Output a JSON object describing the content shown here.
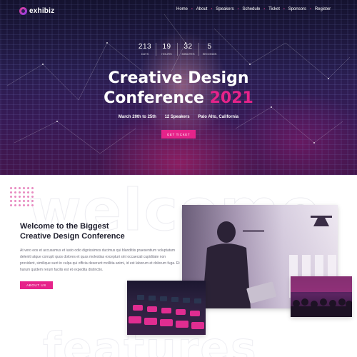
{
  "brand": {
    "name": "exhibiz",
    "accent": "#e6238a"
  },
  "nav": {
    "items": [
      "Home",
      "About",
      "Speakers",
      "Schedule",
      "Ticket",
      "Sponsors",
      "Register"
    ]
  },
  "countdown": [
    {
      "value": "213",
      "label": "Days"
    },
    {
      "value": "19",
      "label": "Hours"
    },
    {
      "value": "32",
      "label": "Minutes"
    },
    {
      "value": "5",
      "label": "Seconds"
    }
  ],
  "hero": {
    "title_line1": "Creative Design",
    "title_line2": "Conference",
    "title_year": "2021",
    "date": "March 20th to 25th",
    "speakers": "12 Speakers",
    "location": "Palo Alto, California",
    "button": "GET TICKET"
  },
  "welcome": {
    "watermark": "welcome",
    "title_line1": "Welcome to the Biggest",
    "title_line2": "Creative Design Conference",
    "body": "At vero eos et accusamus et iusto odio dignissimos ducimus qui blanditiis praesentium voluptatum deleniti atque corrupti quos dolores et quas molestias excepturi sint occaecati cupiditate non provident, similique sunt in culpa qui officia deserunt mollitia animi, id est laborum et dolorum fuga. Et harum quidem rerum facilis est et expedita distinctio.",
    "button": "ABOUT US"
  },
  "features": {
    "watermark": "features"
  }
}
